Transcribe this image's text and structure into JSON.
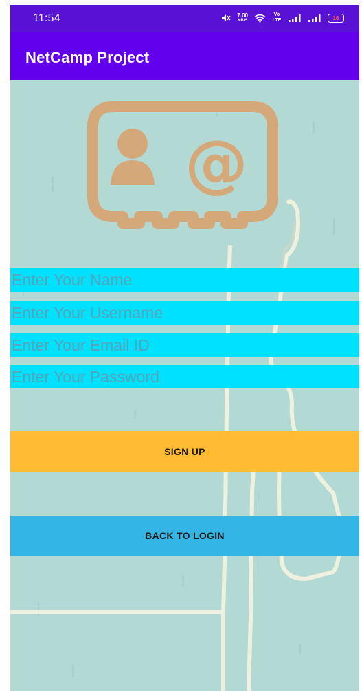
{
  "status_bar": {
    "time": "11:54",
    "net_speed_value": "7.00",
    "net_speed_unit": "KB/S",
    "network_label": "Vo LTE",
    "battery": "16",
    "icons": [
      "mute-icon",
      "wifi-icon",
      "signal-icon",
      "signal-icon",
      "battery-icon"
    ]
  },
  "app_bar": {
    "title": "NetCamp Project"
  },
  "form": {
    "name_placeholder": "Enter Your Name",
    "username_placeholder": "Enter Your Username",
    "email_placeholder": "Enter Your Email ID",
    "password_placeholder": "Enter Your Password"
  },
  "buttons": {
    "signup": "SIGN UP",
    "back_to_login": "BACK TO LOGIN"
  },
  "colors": {
    "status_bar": "#5a11d6",
    "app_bar": "#6200ee",
    "background": "#b3d9d4",
    "input_fill": "#00e0ff",
    "signup_button": "#ffbb33",
    "login_button": "#33b5e5",
    "contact_icon": "#d4a878"
  }
}
